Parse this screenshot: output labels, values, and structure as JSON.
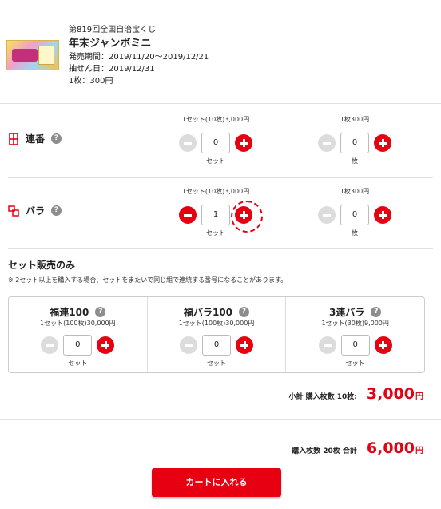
{
  "product": {
    "round": "第819回全国自治宝くじ",
    "name": "年末ジャンボミニ",
    "sale_period": "発売期間：2019/11/20〜2019/12/21",
    "draw_date": "抽せん日：2019/12/31",
    "unit_price": "1枚：300円"
  },
  "rows": [
    {
      "label": "連番",
      "set_caption": "1セット(10枚)3,000円",
      "set_value": "0",
      "set_unit": "セット",
      "single_caption": "1枚300円",
      "single_value": "0",
      "single_unit": "枚"
    },
    {
      "label": "バラ",
      "set_caption": "1セット(10枚)3,000円",
      "set_value": "1",
      "set_unit": "セット",
      "single_caption": "1枚300円",
      "single_value": "0",
      "single_unit": "枚"
    }
  ],
  "help_glyph": "?",
  "set_only": {
    "title": "セット販売のみ",
    "note": "※ 2セット以上を購入する場合、セットをまたいで同じ組で連続する番号になることがあります。",
    "items": [
      {
        "name": "福連100",
        "caption": "1セット(100枚)30,000円",
        "value": "0",
        "unit": "セット"
      },
      {
        "name": "福バラ100",
        "caption": "1セット(100枚)30,000円",
        "value": "0",
        "unit": "セット"
      },
      {
        "name": "3連バラ",
        "caption": "1セット(30枚)9,000円",
        "value": "0",
        "unit": "セット"
      }
    ]
  },
  "subtotal": {
    "label": "小計 購入枚数 10枚:",
    "amount": "3,000",
    "yen": "円"
  },
  "total": {
    "label": "購入枚数 20枚 合計",
    "amount": "6,000",
    "yen": "円"
  },
  "cart_button": "カートに入れる",
  "colors": {
    "accent": "#e60012",
    "disabled": "#dcdcdc",
    "help": "#8d8d8d"
  }
}
